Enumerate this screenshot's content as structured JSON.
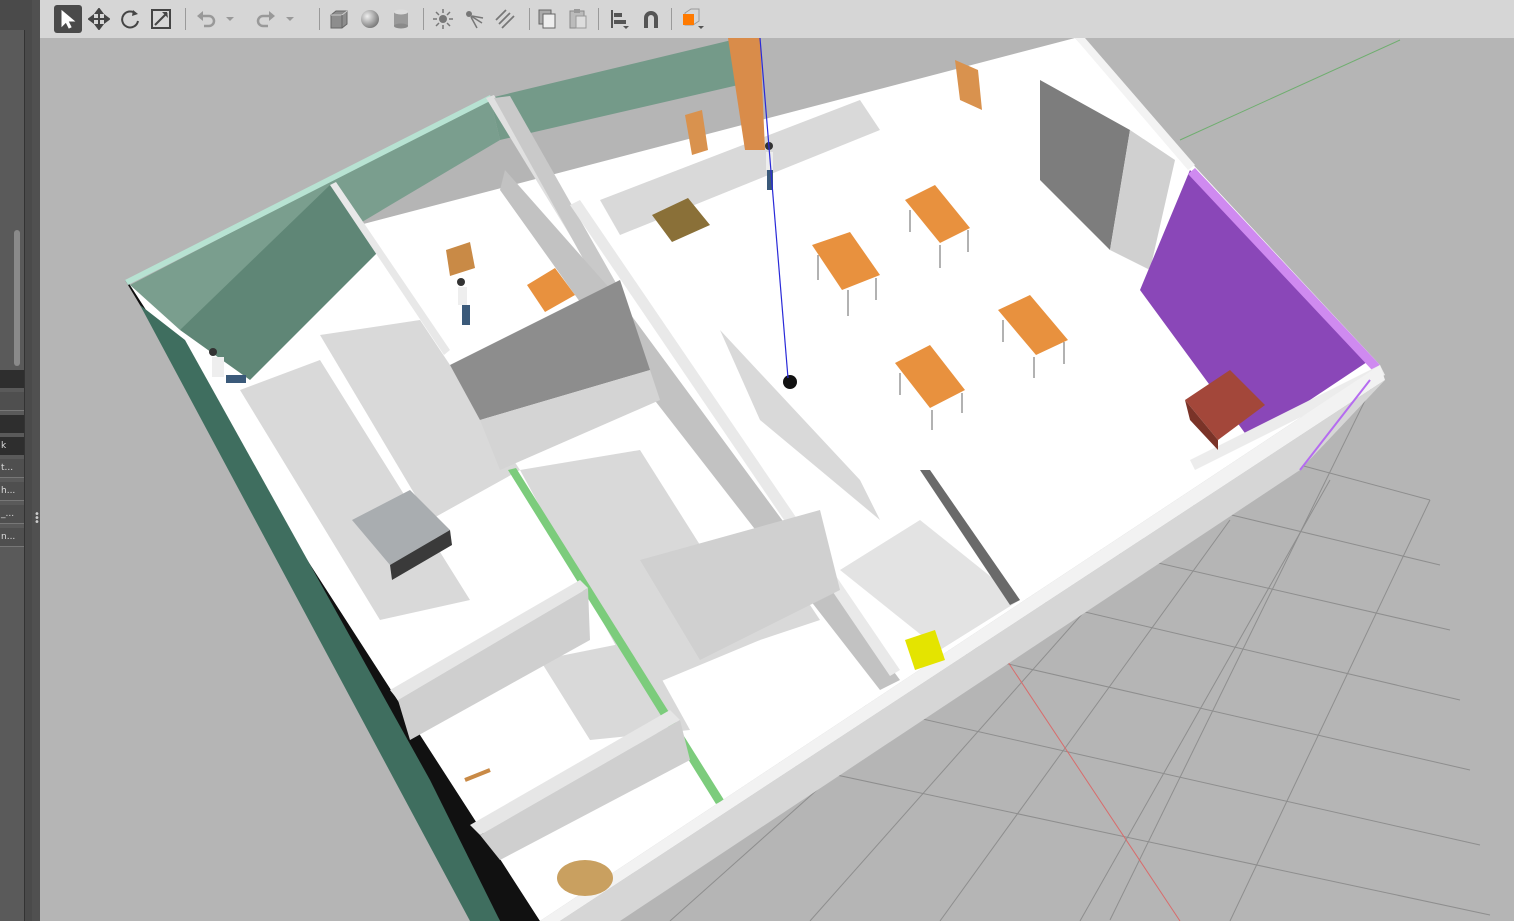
{
  "left_panel": {
    "tree_rows": [
      "k",
      "t...",
      "h...",
      "_...",
      "n..."
    ]
  },
  "toolbar": {
    "tools": [
      {
        "name": "select-mode",
        "icon": "cursor-arrow-icon",
        "active": true
      },
      {
        "name": "translate-mode",
        "icon": "move-arrows-icon"
      },
      {
        "name": "rotate-mode",
        "icon": "rotate-icon"
      },
      {
        "name": "scale-mode",
        "icon": "scale-icon"
      },
      {
        "name": "undo",
        "icon": "undo-icon"
      },
      {
        "name": "undo-history",
        "icon": "chevron-down-icon"
      },
      {
        "name": "redo",
        "icon": "redo-icon"
      },
      {
        "name": "redo-history",
        "icon": "chevron-down-icon"
      },
      {
        "name": "box-shape",
        "icon": "box-icon"
      },
      {
        "name": "sphere-shape",
        "icon": "sphere-icon"
      },
      {
        "name": "cylinder-shape",
        "icon": "cylinder-icon"
      },
      {
        "name": "point-light",
        "icon": "point-light-icon"
      },
      {
        "name": "spot-light",
        "icon": "spot-light-icon"
      },
      {
        "name": "directional-light",
        "icon": "directional-light-icon"
      },
      {
        "name": "copy",
        "icon": "copy-icon"
      },
      {
        "name": "paste",
        "icon": "paste-icon"
      },
      {
        "name": "align",
        "icon": "align-icon"
      },
      {
        "name": "snap",
        "icon": "magnet-icon"
      },
      {
        "name": "view-angle",
        "icon": "view-cube-icon"
      }
    ]
  },
  "scene": {
    "colors": {
      "ground": "#b5b5b5",
      "floor": "#ffffff",
      "wall_gray": "#d2d2d2",
      "wall_green": "#7a9e8e",
      "wall_purple": "#8a47b8",
      "table_orange": "#e8913e",
      "brick": "#9c4a3a",
      "grid_line": "#8e8e8e"
    }
  }
}
